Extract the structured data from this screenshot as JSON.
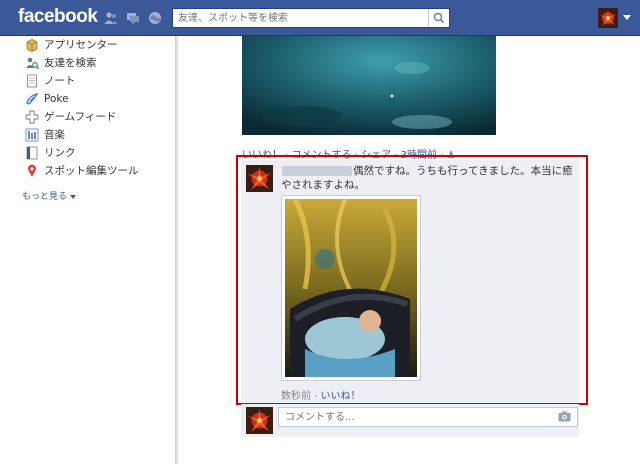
{
  "header": {
    "logo": "facebook",
    "search_placeholder": "友達、スポット等を検索",
    "icons": [
      "friend-requests-icon",
      "messages-icon",
      "notifications-icon"
    ],
    "color": "#3b5998"
  },
  "sidebar": {
    "items": [
      {
        "label": "アプリセンター",
        "icon": "app-center-icon"
      },
      {
        "label": "友達を検索",
        "icon": "find-friends-icon"
      },
      {
        "label": "ノート",
        "icon": "notes-icon"
      },
      {
        "label": "Poke",
        "icon": "poke-icon"
      },
      {
        "label": "ゲームフィード",
        "icon": "game-feed-icon"
      },
      {
        "label": "音楽",
        "icon": "music-icon"
      },
      {
        "label": "リンク",
        "icon": "links-icon"
      },
      {
        "label": "スポット編集ツール",
        "icon": "place-editor-icon"
      }
    ],
    "more_label": "もっと見る"
  },
  "post": {
    "actions": {
      "like": "いいね！",
      "comment": "コメントする",
      "share": "シェア",
      "time": "3時間前"
    }
  },
  "comment": {
    "text": "偶然ですね。うちも行ってきました。本当に癒やされますよね。",
    "time": "数秒前",
    "like": "いいね！"
  },
  "reply": {
    "placeholder": "コメントする..."
  },
  "highlight_color": "#cc0000"
}
